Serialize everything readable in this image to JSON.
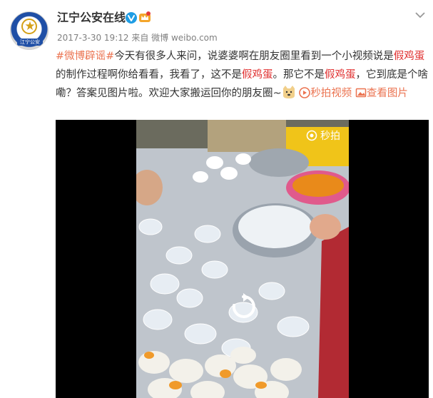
{
  "account": {
    "name": "江宁公安在线",
    "avatar_label": "江宁公安"
  },
  "meta": {
    "timestamp": "2017-3-30 19:12",
    "from_label": "来自",
    "source": "微博 weibo.com"
  },
  "post": {
    "hashtag": "#微博辟谣#",
    "text_1": "今天有很多人来问，说婆婆啊在朋友圈里看到一个小视频说是",
    "keyword_1": "假鸡蛋",
    "text_2": "的制作过程啊你给看看，我看了，这不是",
    "keyword_2": "假鸡蛋",
    "text_3": "。那它不是",
    "keyword_3": "假鸡蛋",
    "text_4": "，它到底是个啥嘞？答案见图片啦。欢迎大家搬运回你的朋友圈~",
    "video_link": "秒拍视频",
    "image_link": "查看图片"
  },
  "video": {
    "overlay_brand": "秒拍"
  },
  "icons": {
    "verified": "verified-v-icon",
    "vip": "crown-icon",
    "dropdown": "chevron-down-icon",
    "emoji": "doge-emoji-icon",
    "video_link": "video-link-icon",
    "image_link": "image-link-icon",
    "replay": "replay-icon"
  },
  "colors": {
    "link": "#eb7350",
    "keyword": "#e03030",
    "username": "#333333",
    "meta": "#808080",
    "verified": "#1f9de4"
  }
}
